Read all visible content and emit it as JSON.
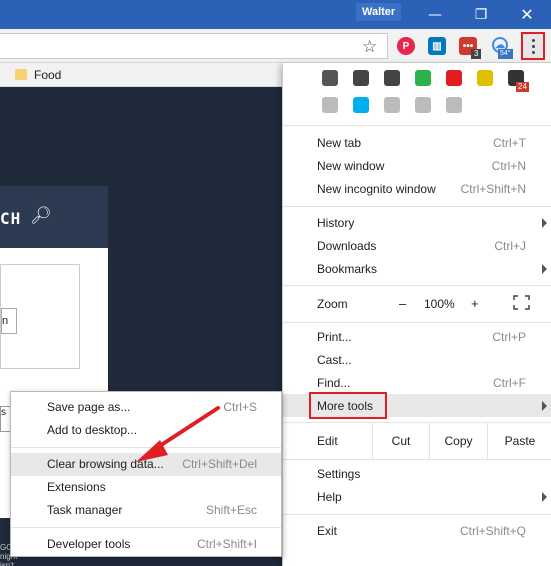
{
  "window": {
    "user_name": "Walter",
    "minimize": "—",
    "maximize": "❐",
    "close": "✕"
  },
  "toolbar": {
    "star": "☆",
    "extensions": [
      {
        "name": "pinterest-extension",
        "color": "#e8244f",
        "glyph": "P"
      },
      {
        "name": "trello-extension",
        "color": "#0079bf",
        "glyph": "▥"
      },
      {
        "name": "lastpass-extension",
        "color": "#d1392f",
        "glyph": "•••",
        "badge": "3"
      },
      {
        "name": "weather-extension",
        "color": "#4285f4",
        "glyph": "☁",
        "badge": "54°"
      }
    ]
  },
  "bookmarks": {
    "items": [
      {
        "label": "Food"
      }
    ]
  },
  "page": {
    "search_label": "CH",
    "button_text": "n",
    "strip_text": "s",
    "foot_text": "GC\nnight isn't"
  },
  "menu": {
    "extension_icons": [
      {
        "name": "pocket-icon",
        "color": "#555"
      },
      {
        "name": "keep-icon",
        "color": "#444"
      },
      {
        "name": "inbox-icon",
        "color": "#444"
      },
      {
        "name": "feedly-icon",
        "color": "#2bb24c"
      },
      {
        "name": "adobe-icon",
        "color": "#e31b23"
      },
      {
        "name": "star-extension-icon",
        "color": "#e0c000"
      },
      {
        "name": "flag-extension-icon",
        "color": "#333",
        "badge": "24"
      },
      {
        "name": "camera-icon",
        "color": "#bbb"
      },
      {
        "name": "skype-icon",
        "color": "#00aff0"
      },
      {
        "name": "evernote-icon",
        "color": "#bbb"
      },
      {
        "name": "image-icon",
        "color": "#bbb"
      },
      {
        "name": "shield-ext-icon",
        "color": "#bbb"
      }
    ],
    "group1": [
      {
        "label": "New tab",
        "shortcut": "Ctrl+T"
      },
      {
        "label": "New window",
        "shortcut": "Ctrl+N"
      },
      {
        "label": "New incognito window",
        "shortcut": "Ctrl+Shift+N"
      }
    ],
    "group2": [
      {
        "label": "History",
        "shortcut": "",
        "submenu": true
      },
      {
        "label": "Downloads",
        "shortcut": "Ctrl+J"
      },
      {
        "label": "Bookmarks",
        "shortcut": "",
        "submenu": true
      }
    ],
    "zoom": {
      "label": "Zoom",
      "minus": "–",
      "value": "100%",
      "plus": "+"
    },
    "group3": [
      {
        "label": "Print...",
        "shortcut": "Ctrl+P"
      },
      {
        "label": "Cast...",
        "shortcut": ""
      },
      {
        "label": "Find...",
        "shortcut": "Ctrl+F"
      },
      {
        "label": "More tools",
        "shortcut": "",
        "submenu": true
      }
    ],
    "edit": {
      "label": "Edit",
      "cut": "Cut",
      "copy": "Copy",
      "paste": "Paste"
    },
    "group4": [
      {
        "label": "Settings",
        "shortcut": ""
      },
      {
        "label": "Help",
        "shortcut": "",
        "submenu": true
      }
    ],
    "exit": {
      "label": "Exit",
      "shortcut": "Ctrl+Shift+Q"
    }
  },
  "submenu": {
    "items": [
      {
        "label": "Save page as...",
        "shortcut": "Ctrl+S"
      },
      {
        "label": "Add to desktop...",
        "shortcut": ""
      },
      {
        "label": "Clear browsing data...",
        "shortcut": "Ctrl+Shift+Del"
      },
      {
        "label": "Extensions",
        "shortcut": ""
      },
      {
        "label": "Task manager",
        "shortcut": "Shift+Esc"
      },
      {
        "label": "Developer tools",
        "shortcut": "Ctrl+Shift+I"
      }
    ]
  },
  "colors": {
    "titlebar": "#2b62b8",
    "highlight": "#e01e25",
    "page_bg": "#1f2a3a"
  }
}
